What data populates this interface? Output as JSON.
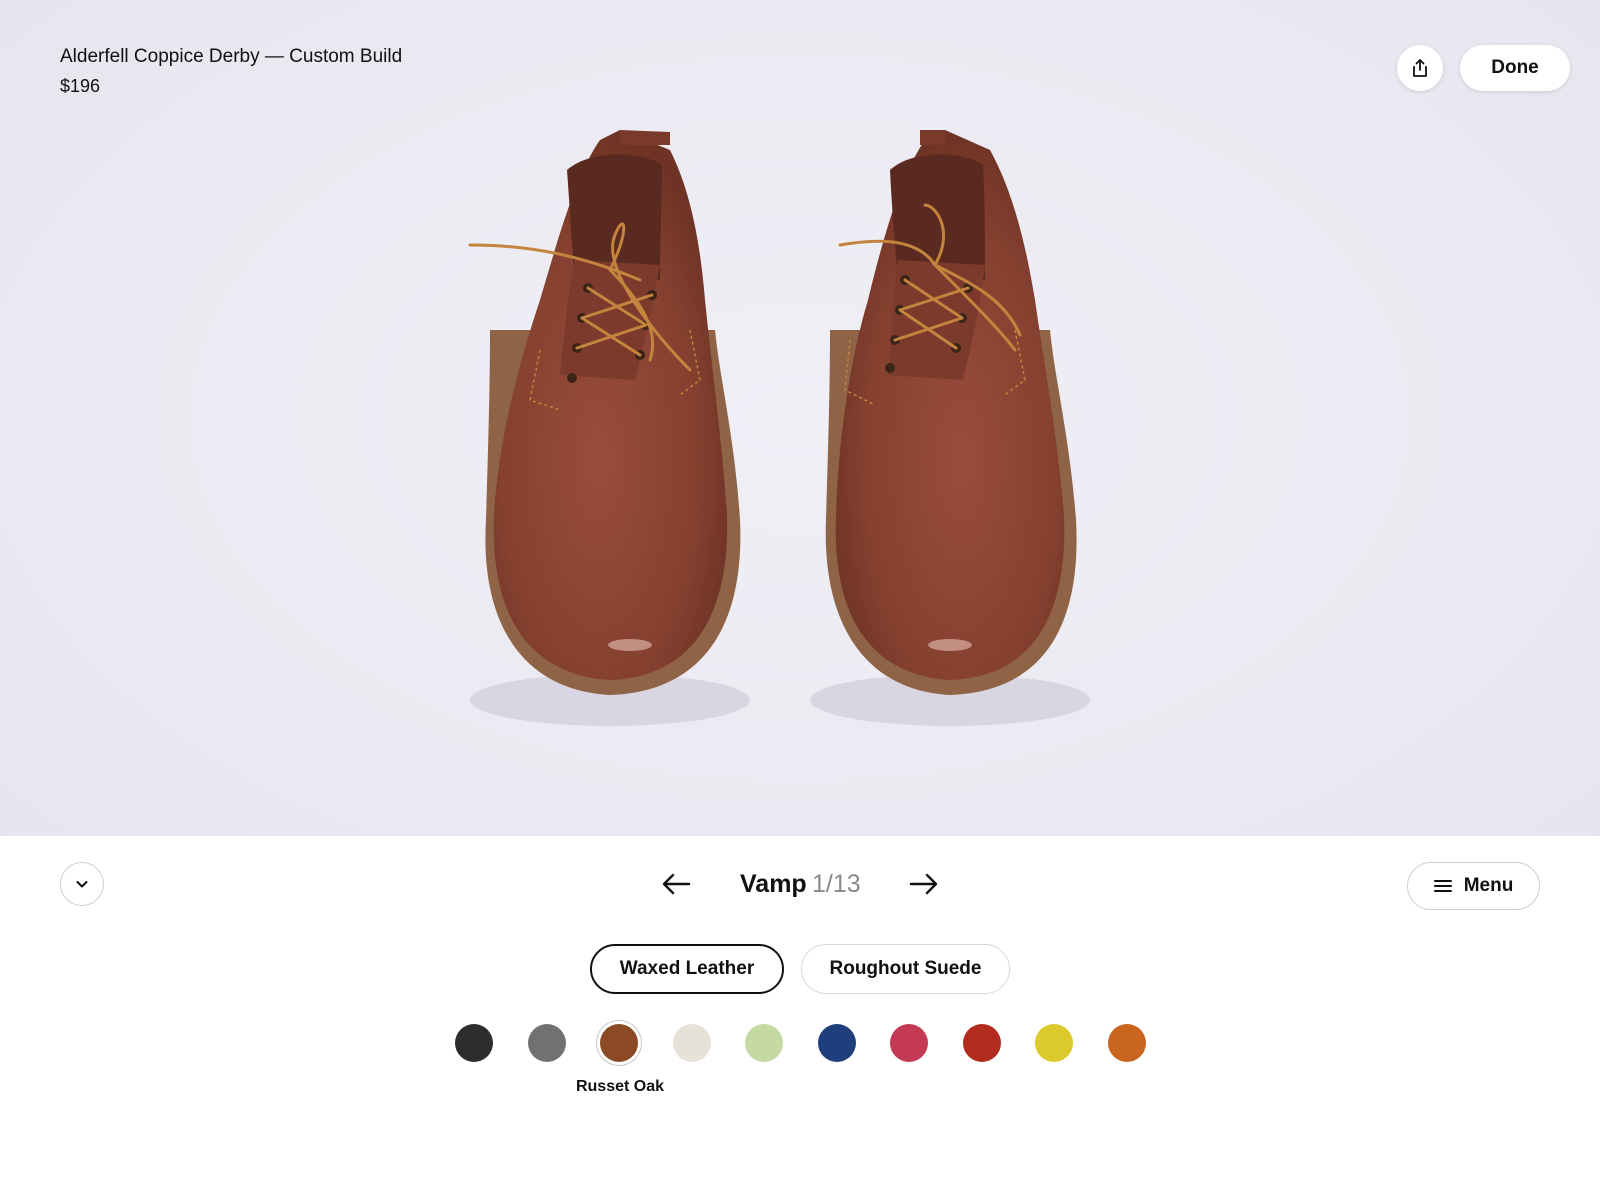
{
  "product": {
    "title": "Alderfell Coppice Derby — Custom Build",
    "price": "$196"
  },
  "header": {
    "done_label": "Done",
    "share_icon": "share-icon"
  },
  "stepper": {
    "label": "Vamp",
    "count": "1/13",
    "prev_icon": "arrow-left-icon",
    "next_icon": "arrow-right-icon"
  },
  "menu": {
    "label": "Menu",
    "icon": "hamburger-icon"
  },
  "collapse": {
    "icon": "chevron-down-icon"
  },
  "materials": {
    "tabs": [
      {
        "label": "Waxed Leather",
        "active": true
      },
      {
        "label": "Roughout Suede",
        "active": false
      }
    ]
  },
  "colors": {
    "selected_name": "Russet Oak",
    "swatches": [
      {
        "hex": "#2c2e2c"
      },
      {
        "hex": "#707271"
      },
      {
        "hex": "#8b4a25",
        "selected": true
      },
      {
        "hex": "#e7e2d8"
      },
      {
        "hex": "#c5d9a2"
      },
      {
        "hex": "#1e3f7c"
      },
      {
        "hex": "#c43a54"
      },
      {
        "hex": "#b22c1e"
      },
      {
        "hex": "#dcc92b"
      },
      {
        "hex": "#c9651f"
      }
    ]
  },
  "image": {
    "leather_hex": "#8c4334",
    "lace_hex": "#c4843e",
    "sole_hex": "#8e6346"
  }
}
